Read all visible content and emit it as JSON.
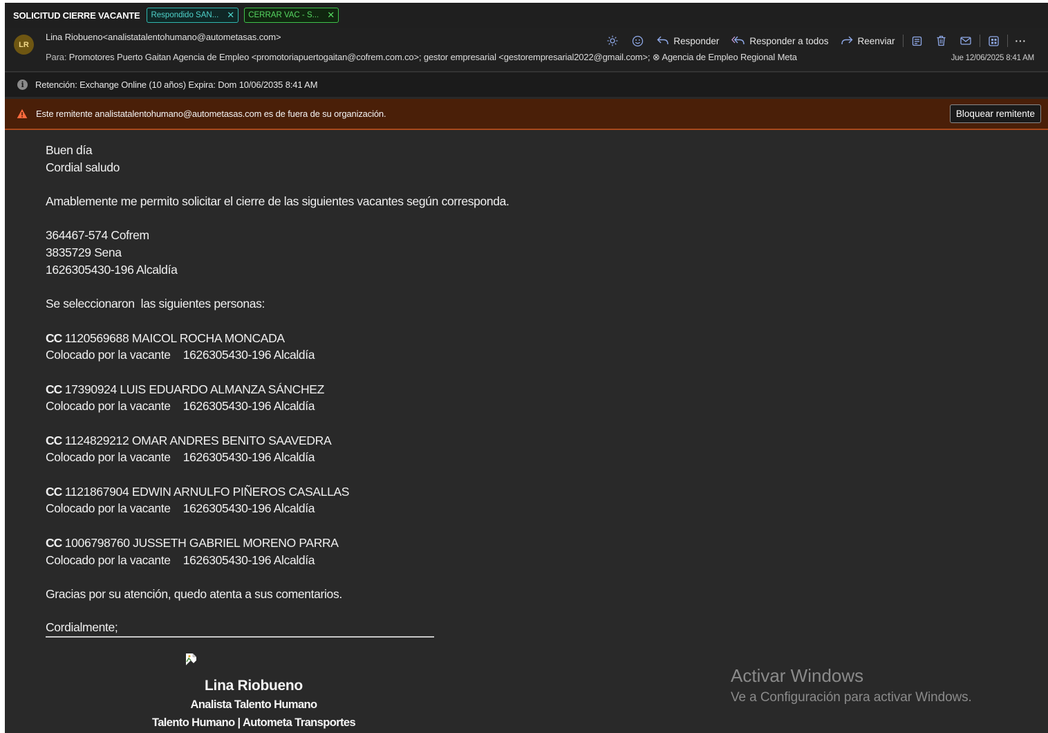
{
  "subject": "SOLICITUD CIERRE VACANTE",
  "tags": [
    {
      "label": "Respondido SAN...",
      "close": "✕"
    },
    {
      "label": "CERRAR VAC - S...",
      "close": "✕"
    }
  ],
  "header": {
    "avatar_initials": "LR",
    "sender": "Lina Riobueno<analistatalentohumano@autometasas.com>",
    "to_label": "Para:",
    "to": "Promotores Puerto Gaitan Agencia de Empleo <promotoriapuertogaitan@cofrem.com.co>;  gestor empresarial <gestorempresarial2022@gmail.com>;  ⊗ Agencia de Empleo Regional Meta",
    "date": "Jue 12/06/2025 8:41 AM",
    "actions": {
      "reply": "Responder",
      "reply_all": "Responder a todos",
      "forward": "Reenviar",
      "more": "···"
    }
  },
  "retention": {
    "icon": "i",
    "text": "Retención: Exchange Online (10 años) Expira: Dom 10/06/2035 8:41 AM"
  },
  "warning": {
    "text": "Este remitente analistatalentohumano@autometasas.com es de fuera de su organización.",
    "button": "Bloquear remitente"
  },
  "body": {
    "greeting1": "Buen día",
    "greeting2": "Cordial saludo",
    "request": "Amablemente me permito solicitar el cierre de las siguientes vacantes según corresponda.",
    "vacancies": [
      "364467-574 Cofrem",
      "3835729 Sena",
      "1626305430-196 Alcaldía"
    ],
    "selected_intro": "Se seleccionaron  las siguientes personas:",
    "people": [
      {
        "cc": "CC",
        "id_name": " 1120569688 MAICOL ROCHA MONCADA",
        "placed": "Colocado por la vacante    1626305430-196 Alcaldía"
      },
      {
        "cc": "CC",
        "id_name": " 17390924 LUIS EDUARDO ALMANZA SÁNCHEZ",
        "placed": "Colocado por la vacante    1626305430-196 Alcaldía"
      },
      {
        "cc": "CC",
        "id_name": " 1124829212 OMAR ANDRES BENITO SAAVEDRA",
        "placed": "Colocado por la vacante    1626305430-196 Alcaldía"
      },
      {
        "cc": "CC",
        "id_name": " 1121867904 EDWIN ARNULFO PIÑEROS CASALLAS",
        "placed": "Colocado por la vacante    1626305430-196 Alcaldía"
      },
      {
        "cc": "CC",
        "id_name": " 1006798760 JUSSETH GABRIEL MORENO PARRA",
        "placed": "Colocado por la vacante    1626305430-196 Alcaldía"
      }
    ],
    "thanks": "Gracias por su atención, quedo atenta a sus comentarios.",
    "closing": "Cordialmente;"
  },
  "signature": {
    "name": "Lina Riobueno",
    "role": "Analista Talento Humano",
    "company": "Talento Humano | Autometa Transportes"
  },
  "watermark": {
    "title": "Activar Windows",
    "subtitle": "Ve a Configuración para activar Windows."
  }
}
